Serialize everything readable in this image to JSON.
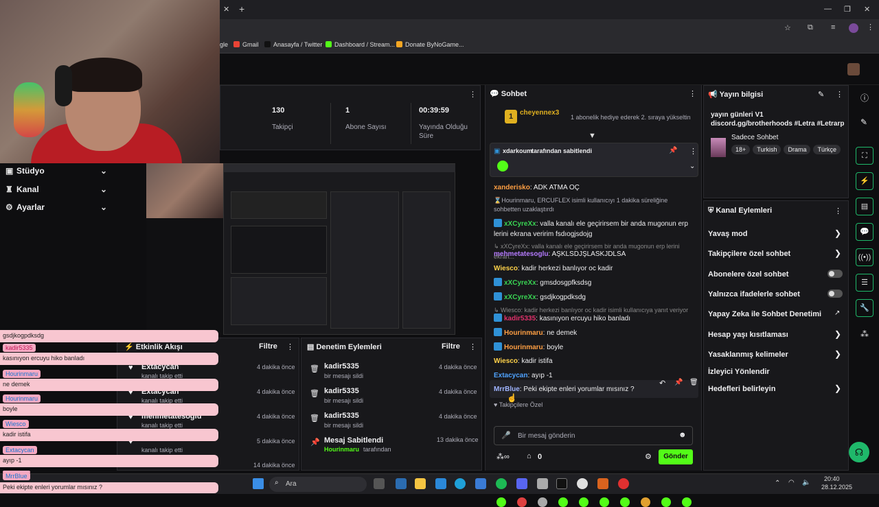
{
  "browser": {
    "bookmarks": [
      "Gmail",
      "Anasayfa / Twitter",
      "Dashboard / Stream...",
      "Donate ByNoGame..."
    ],
    "bookmark_prefix": "gle"
  },
  "stats": [
    {
      "value": "130",
      "label": "Takipçi"
    },
    {
      "value": "1",
      "label": "Abone Sayısı"
    },
    {
      "value": "00:39:59",
      "label": "Yayında Olduğu Süre"
    }
  ],
  "sidebar": {
    "items": [
      {
        "label": "Stüdyo",
        "icon": "studio-icon"
      },
      {
        "label": "Kanal",
        "icon": "channel-icon"
      },
      {
        "label": "Ayarlar",
        "icon": "gear-icon"
      }
    ]
  },
  "overlay": {
    "lines": [
      {
        "type": "text",
        "text": "gsdjkogpdksdg"
      },
      {
        "type": "name",
        "text": "kadir5335"
      },
      {
        "type": "text",
        "text": "kasınıyon ercuyu hiko banladı"
      },
      {
        "type": "name",
        "text": "Hourinmaru"
      },
      {
        "type": "text",
        "text": "ne demek"
      },
      {
        "type": "name",
        "text": "Hourinmaru"
      },
      {
        "type": "text",
        "text": "boyle"
      },
      {
        "type": "name",
        "text": "Wiesco"
      },
      {
        "type": "text",
        "text": "kadir istifa"
      },
      {
        "type": "name",
        "text": "Extacycan"
      },
      {
        "type": "text",
        "text": "ayıp -1"
      },
      {
        "type": "name",
        "text": "MrrBlue"
      },
      {
        "type": "text",
        "text": "Peki ekipte enleri yorumlar mısınız ?"
      }
    ]
  },
  "activity": {
    "title": "Etkinlik Akışı",
    "filter": "Filtre",
    "items": [
      {
        "name": "Extacycan",
        "sub": "kanalı takip etti",
        "time": "4 dakika önce"
      },
      {
        "name": "Extacycan",
        "sub": "kanalı takip etti",
        "time": "4 dakika önce"
      },
      {
        "name": "mehmetatesoglu",
        "sub": "kanalı takip etti",
        "time": "4 dakika önce"
      },
      {
        "name": "",
        "sub": "kanalı takip etti",
        "time": "5 dakika önce"
      },
      {
        "name": "",
        "sub": "",
        "time": "14 dakika önce"
      }
    ]
  },
  "moderation": {
    "title": "Denetim Eylemleri",
    "filter": "Filtre",
    "items": [
      {
        "name": "kadir5335",
        "sub": "bir mesajı sildi",
        "time": "4 dakika önce"
      },
      {
        "name": "kadir5335",
        "sub": "bir mesajı sildi",
        "time": "4 dakika önce"
      },
      {
        "name": "kadir5335",
        "sub": "bir mesajı sildi",
        "time": "4 dakika önce"
      }
    ],
    "pinned": {
      "title": "Mesaj Sabitlendi",
      "user": "Hourinmaru",
      "suffix": "tarafından",
      "time": "13 dakika önce"
    }
  },
  "chat": {
    "title": "Sohbet",
    "hype": {
      "user": "cheyennex3",
      "text": "1 abonelik hediye ederek 2. sıraya yükseltin"
    },
    "pinned_by": "xdarkoum",
    "pinned_suffix": "tarafından sabitlendi",
    "messages": [
      {
        "user": "xanderisko",
        "color": "#ff9f43",
        "text": "ADK ATMA OÇ"
      },
      {
        "system": "Hourinmaru, ERCUFLEX isimli kullanıcıyı 1 dakika süreliğine sohbetten uzaklaştırdı"
      },
      {
        "user": "xXCyreXx",
        "color": "#39d353",
        "badge": true,
        "text": "valla kanalı ele geçirirsem bir anda mugonun erp lerini ekrana veririm fsdıogjsdojg"
      },
      {
        "reply": "xXCyreXx: valla kanalı ele geçirirsem bir anda mugonun erp lerini ekran..."
      },
      {
        "user": "mehmetatesoglu",
        "color": "#b57bff",
        "text": "AŞKLSDJŞLASKJDLSA"
      },
      {
        "user": "Wiesco",
        "color": "#ffd24a",
        "text": "kadir herkezi banlıyor oc kadir"
      },
      {
        "user": "xXCyreXx",
        "color": "#39d353",
        "badge": true,
        "text": "gmsdosgpfksdsg"
      },
      {
        "user": "xXCyreXx",
        "color": "#39d353",
        "badge": true,
        "text": "gsdjkogpdksdg"
      },
      {
        "reply": "Wiesco: kadir herkezi banlıyor oc kadir isimli kullanıcıya yanıt veriyor"
      },
      {
        "user": "kadir5335",
        "color": "#e0306a",
        "badge": true,
        "text": "kasınıyon ercuyu hiko banladı"
      },
      {
        "user": "Hourinmaru",
        "color": "#ff9f43",
        "badge": true,
        "text": "ne demek"
      },
      {
        "user": "Hourinmaru",
        "color": "#ff9f43",
        "badge": true,
        "text": "boyle"
      },
      {
        "user": "Wiesco",
        "color": "#ffd24a",
        "text": "kadir istifa"
      },
      {
        "user": "Extacycan",
        "color": "#4fa3ff",
        "text": "ayıp -1"
      },
      {
        "user": "MrrBlue",
        "color": "#9fb4ff",
        "text": "Peki ekipte enleri yorumlar mısınız ?"
      }
    ],
    "followers_only": "Takipçilere Özel",
    "input_placeholder": "Bir mesaj gönderin",
    "points": "0",
    "send": "Gönder"
  },
  "stream_info": {
    "title": "Yayın bilgisi",
    "text": "yayın günleri V1 discord.gg/brotherhoods #Letra #Letrarp",
    "category": "Sadece Sohbet",
    "tags": [
      "18+",
      "Turkish",
      "Drama",
      "Türkçe"
    ]
  },
  "channel_actions": {
    "title": "Kanal Eylemleri",
    "items": [
      {
        "label": "Yavaş mod",
        "control": "chevron"
      },
      {
        "label": "Takipçilere özel sohbet",
        "control": "chevron"
      },
      {
        "label": "Abonelere özel sohbet",
        "control": "toggle"
      },
      {
        "label": "Yalnızca ifadelerle sohbet",
        "control": "toggle"
      },
      {
        "label": "Yapay Zeka ile Sohbet Denetimi",
        "control": "external"
      },
      {
        "label": "Hesap yaşı kısıtlaması",
        "control": "chevron"
      },
      {
        "label": "Yasaklanmış kelimeler",
        "control": "chevron"
      },
      {
        "label": "İzleyici Yönlendir",
        "control": "none"
      },
      {
        "label": "Hedefleri belirleyin",
        "control": "chevron"
      }
    ]
  },
  "taskbar": {
    "search": "Ara",
    "time": "20:40",
    "date": "28.12.2025"
  }
}
